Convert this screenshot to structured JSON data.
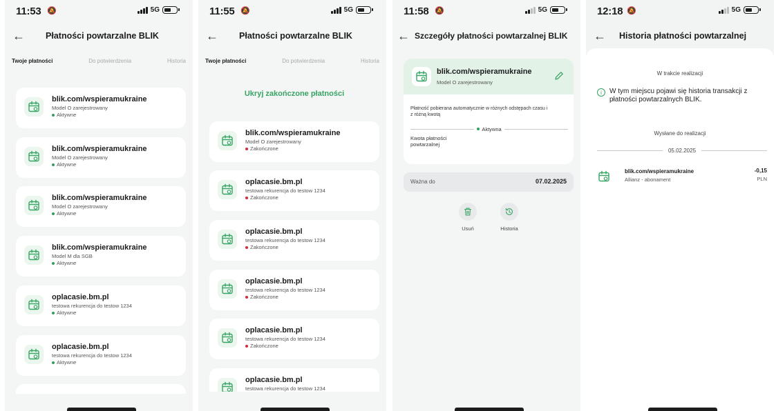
{
  "icons": {
    "alarm": "alarm-off-icon",
    "back": "arrow-left-icon",
    "payment": "calendar-repeat-icon",
    "edit": "pencil-icon",
    "delete": "trash-icon",
    "history": "history-clock-icon",
    "info": "info-circle-icon"
  },
  "colors": {
    "accent_green": "#37a463",
    "active_dot": "#2ea05a",
    "ended_dot": "#d6283a",
    "detail_header": "#e3f2e7"
  },
  "status_bar": {
    "net": "5G"
  },
  "screen1": {
    "time": "11:53",
    "title": "Płatności powtarzalne BLIK",
    "tabs": [
      "Twoje płatności",
      "Do potwierdzenia",
      "Historia"
    ],
    "items": [
      {
        "title": "blik.com/wspieramukraine",
        "subtitle": "Model O zarejestrowany",
        "status": "Aktywne"
      },
      {
        "title": "blik.com/wspieramukraine",
        "subtitle": "Model O zarejestrowany",
        "status": "Aktywne"
      },
      {
        "title": "blik.com/wspieramukraine",
        "subtitle": "Model O zarejestrowany",
        "status": "Aktywne"
      },
      {
        "title": "blik.com/wspieramukraine",
        "subtitle": "Model M dla SGB",
        "status": "Aktywne"
      },
      {
        "title": "oplacasie.bm.pl",
        "subtitle": "testowa rekurencja do testow 1234",
        "status": "Aktywne"
      },
      {
        "title": "oplacasie.bm.pl",
        "subtitle": "testowa rekurencja do testow 1234",
        "status": "Aktywne"
      }
    ]
  },
  "screen2": {
    "time": "11:55",
    "title": "Płatności powtarzalne BLIK",
    "tabs": [
      "Twoje płatności",
      "Do potwierdzenia",
      "Historia"
    ],
    "hide_label": "Ukryj zakończone płatności",
    "items": [
      {
        "title": "blik.com/wspieramukraine",
        "subtitle": "Model O zarejestrowany",
        "status": "Zakończone"
      },
      {
        "title": "oplacasie.bm.pl",
        "subtitle": "testowa rekurencja do testow 1234",
        "status": "Zakończone"
      },
      {
        "title": "oplacasie.bm.pl",
        "subtitle": "testowa rekurencja do testow 1234",
        "status": "Zakończone"
      },
      {
        "title": "oplacasie.bm.pl",
        "subtitle": "testowa rekurencja do testow 1234",
        "status": "Zakończone"
      },
      {
        "title": "oplacasie.bm.pl",
        "subtitle": "testowa rekurencja do testow 1234",
        "status": "Zakończone"
      },
      {
        "title": "oplacasie.bm.pl",
        "subtitle": "testowa rekurencja do testow 1234",
        "status": ""
      }
    ]
  },
  "screen3": {
    "time": "11:58",
    "title": "Szczegóły płatności powtarzalnej BLIK",
    "card": {
      "title": "blik.com/wspieramukraine",
      "subtitle": "Model O zarejestrowany",
      "info": "Płatność pobierana automatycznie w różnych odstępach czasu i z różną kwotą",
      "status": "Aktywna",
      "amount_label": "Kwota płatności powtarzalnej"
    },
    "valid_label": "Ważna do",
    "valid_date": "07.02.2025",
    "actions": {
      "delete": "Usuń",
      "history": "Historia"
    }
  },
  "screen4": {
    "time": "12:18",
    "title": "Historia płatności powtarzalnej",
    "in_progress": "W trakcie realizacji",
    "info": "W tym miejscu pojawi się historia transakcji z płatności powtarzalnych BLIK.",
    "sent": "Wysłane do realizacji",
    "date": "05.02.2025",
    "transaction": {
      "title": "blik.com/wspieramukraine",
      "subtitle": "Allianz - abonament",
      "amount": "-0,15",
      "currency": "PLN"
    }
  }
}
